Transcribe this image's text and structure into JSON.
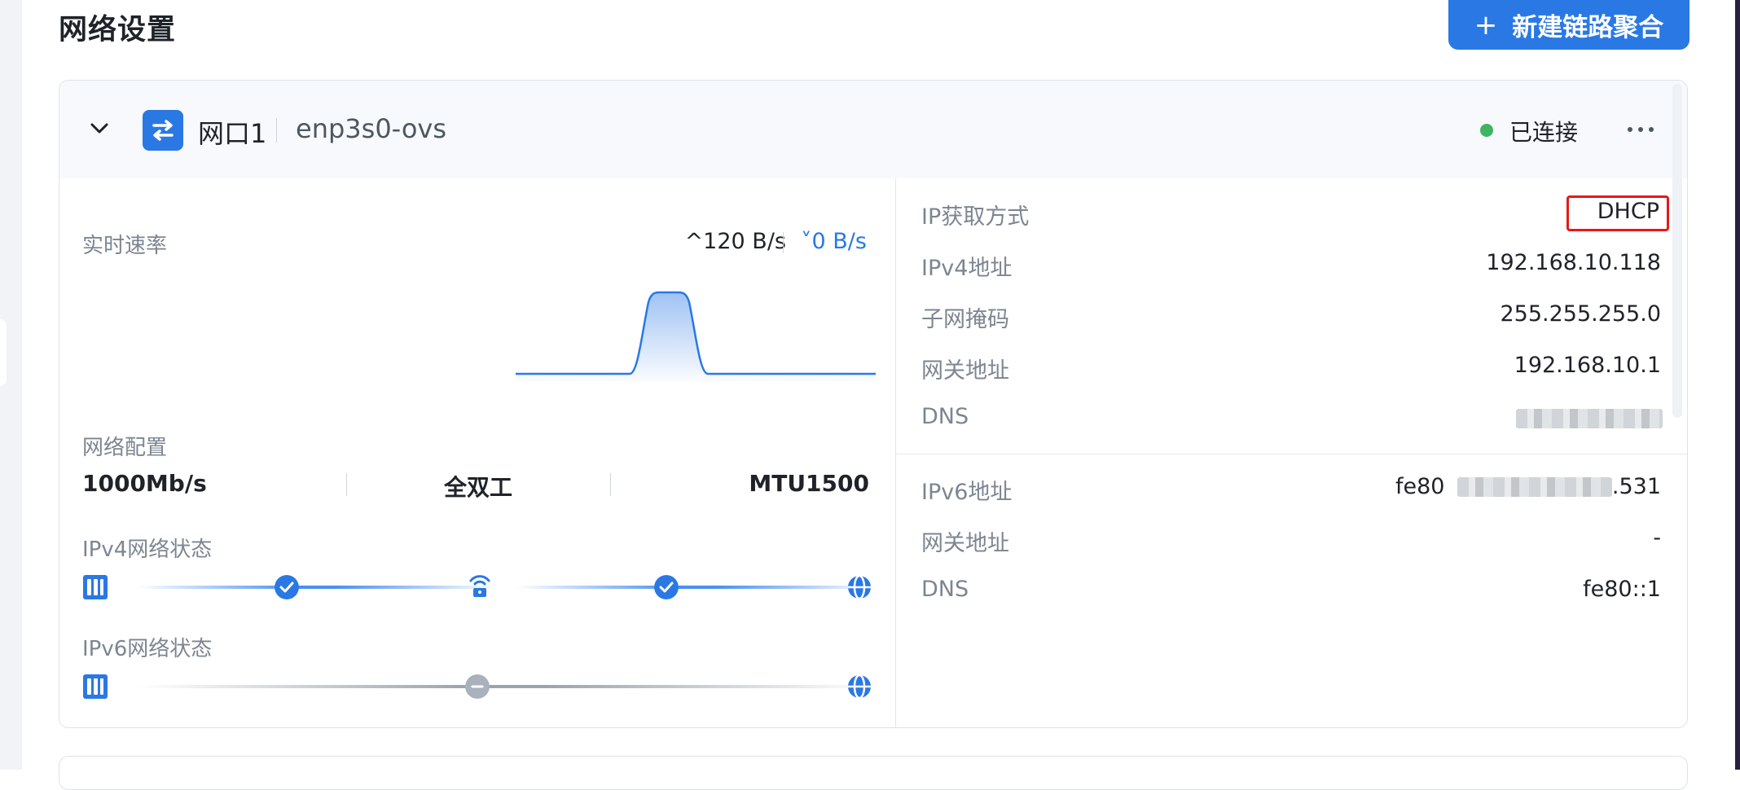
{
  "page": {
    "title": "网络设置"
  },
  "toolbar": {
    "new_aggregation_label": "新建链路聚合",
    "plus_glyph": "+"
  },
  "port": {
    "name": "网口1",
    "interface": "enp3s0-ovs",
    "status": "已连接",
    "status_color": "#3fb462"
  },
  "rate": {
    "label": "实时速率",
    "upload": "^120 B/s",
    "download": "˅0 B/s"
  },
  "config": {
    "label": "网络配置",
    "speed": "1000Mb/s",
    "duplex": "全双工",
    "mtu": "MTU1500"
  },
  "ipv4_status": {
    "label": "IPv4网络状态"
  },
  "ipv6_status": {
    "label": "IPv6网络状态"
  },
  "ipv4": {
    "method_label": "IP获取方式",
    "method": "DHCP",
    "address_label": "IPv4地址",
    "address": "192.168.10.118",
    "mask_label": "子网掩码",
    "mask": "255.255.255.0",
    "gateway_label": "网关地址",
    "gateway": "192.168.10.1",
    "dns_label": "DNS"
  },
  "ipv6": {
    "address_label": "IPv6地址",
    "address_prefix": "fe80",
    "address_suffix": ".531",
    "gateway_label": "网关地址",
    "gateway": "-",
    "dns_label": "DNS",
    "dns": "fe80::1"
  },
  "colors": {
    "accent": "#2a78e4",
    "highlight_box": "#e81919",
    "neutral_node": "#a9b1bd"
  },
  "icons": [
    "chevron-down-icon",
    "port-swap-icon",
    "more-icon",
    "server-icon",
    "router-icon",
    "globe-icon",
    "check-icon",
    "minus-icon"
  ]
}
